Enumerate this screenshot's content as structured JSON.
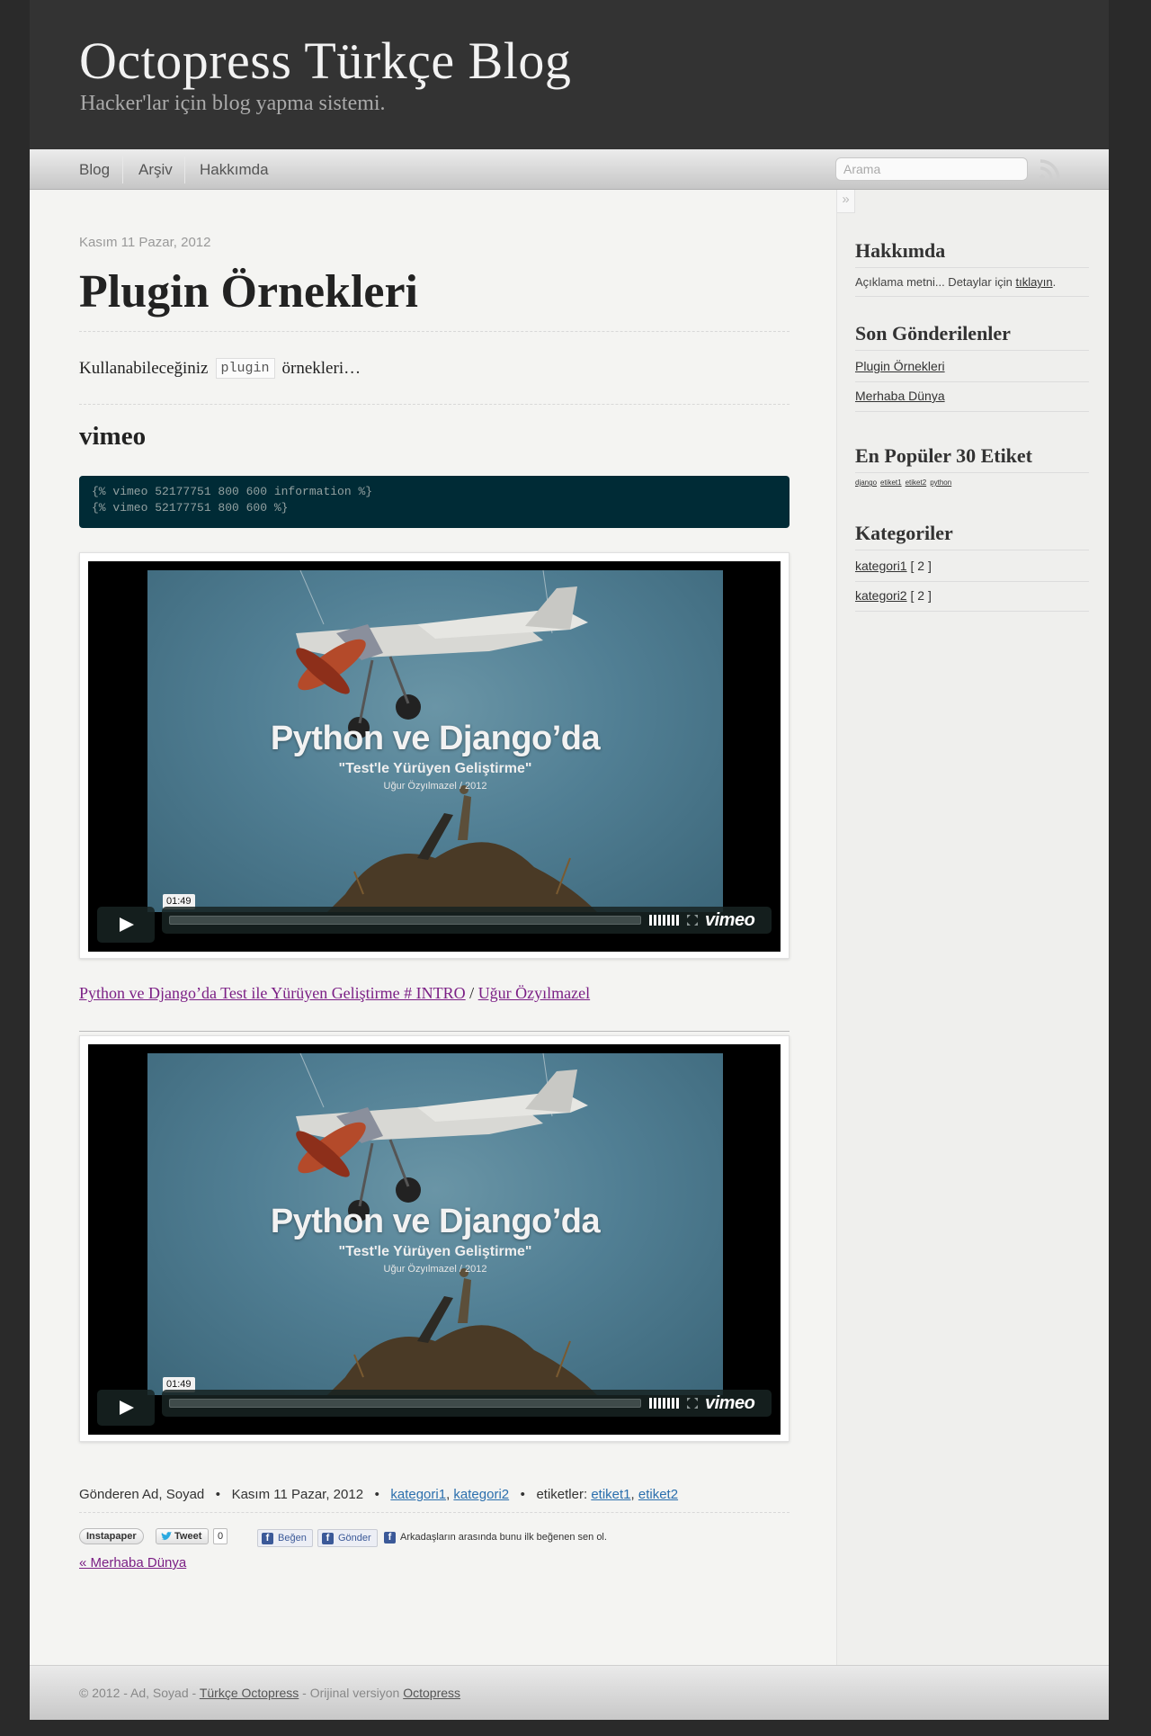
{
  "site": {
    "title": "Octopress Türkçe Blog",
    "subtitle": "Hacker'lar için blog yapma sistemi."
  },
  "nav": {
    "items": [
      {
        "label": "Blog"
      },
      {
        "label": "Arşiv"
      },
      {
        "label": "Hakkımda"
      }
    ],
    "search_placeholder": "Arama",
    "rss_icon": "rss-icon"
  },
  "post": {
    "date": "Kasım 11 Pazar, 2012",
    "title": "Plugin Örnekleri",
    "intro_before": "Kullanabileceğiniz",
    "intro_code": "plugin",
    "intro_after": "örnekleri…",
    "section_heading": "vimeo",
    "code_lines": [
      "{% vimeo 52177751 800 600 information %}",
      "{% vimeo 52177751 800 600 %}"
    ],
    "videos": [
      {
        "title": "Python ve Django’da",
        "subtitle": "\"Test'le Yürüyen Geliştirme\"",
        "credit": "Uğur Özyılmazel / 2012",
        "timecode": "01:49",
        "logo": "vimeo"
      },
      {
        "title": "Python ve Django’da",
        "subtitle": "\"Test'le Yürüyen Geliştirme\"",
        "credit": "Uğur Özyılmazel / 2012",
        "timecode": "01:49",
        "logo": "vimeo"
      }
    ],
    "caption_link": "Python ve Django’da Test ile Yürüyen Geliştirme # INTRO",
    "caption_sep": " / ",
    "caption_author": "Uğur Özyılmazel",
    "meta": {
      "author": "Gönderen Ad, Soyad",
      "bullet": "•",
      "date": "Kasım 11 Pazar, 2012",
      "categories": [
        "kategori1",
        "kategori2"
      ],
      "tags_label": "etiketler:",
      "tags": [
        "etiket1",
        "etiket2"
      ]
    },
    "share": {
      "instapaper": "Instapaper",
      "tweet": "Tweet",
      "tweet_count": "0",
      "fb_like": "Beğen",
      "fb_send": "Gönder",
      "fb_text": "Arkadaşların arasında bunu ilk beğenen sen ol."
    },
    "prev_link": "« Merhaba Dünya"
  },
  "sidebar": {
    "collapse": "»",
    "about": {
      "heading": "Hakkımda",
      "text": "Açıklama metni... Detaylar için",
      "link": "tıklayın",
      "text_end": "."
    },
    "recent": {
      "heading": "Son Gönderilenler",
      "items": [
        "Plugin Örnekleri",
        "Merhaba Dünya"
      ]
    },
    "tags": {
      "heading": "En Popüler 30 Etiket",
      "items": [
        "django",
        "etiket1",
        "etiket2",
        "python"
      ]
    },
    "categories": {
      "heading": "Kategoriler",
      "items": [
        {
          "label": "kategori1",
          "count": "[ 2 ]"
        },
        {
          "label": "kategori2",
          "count": "[ 2 ]"
        }
      ]
    }
  },
  "footer": {
    "prefix": "© 2012 - Ad, Soyad - ",
    "link1": "Türkçe Octopress",
    "middle": " - Orijinal versiyon ",
    "link2": "Octopress"
  },
  "colors": {
    "header_bg": "#333333",
    "code_bg": "#002b36",
    "link_purple": "#7b1f85",
    "link_blue": "#2b6fad"
  }
}
